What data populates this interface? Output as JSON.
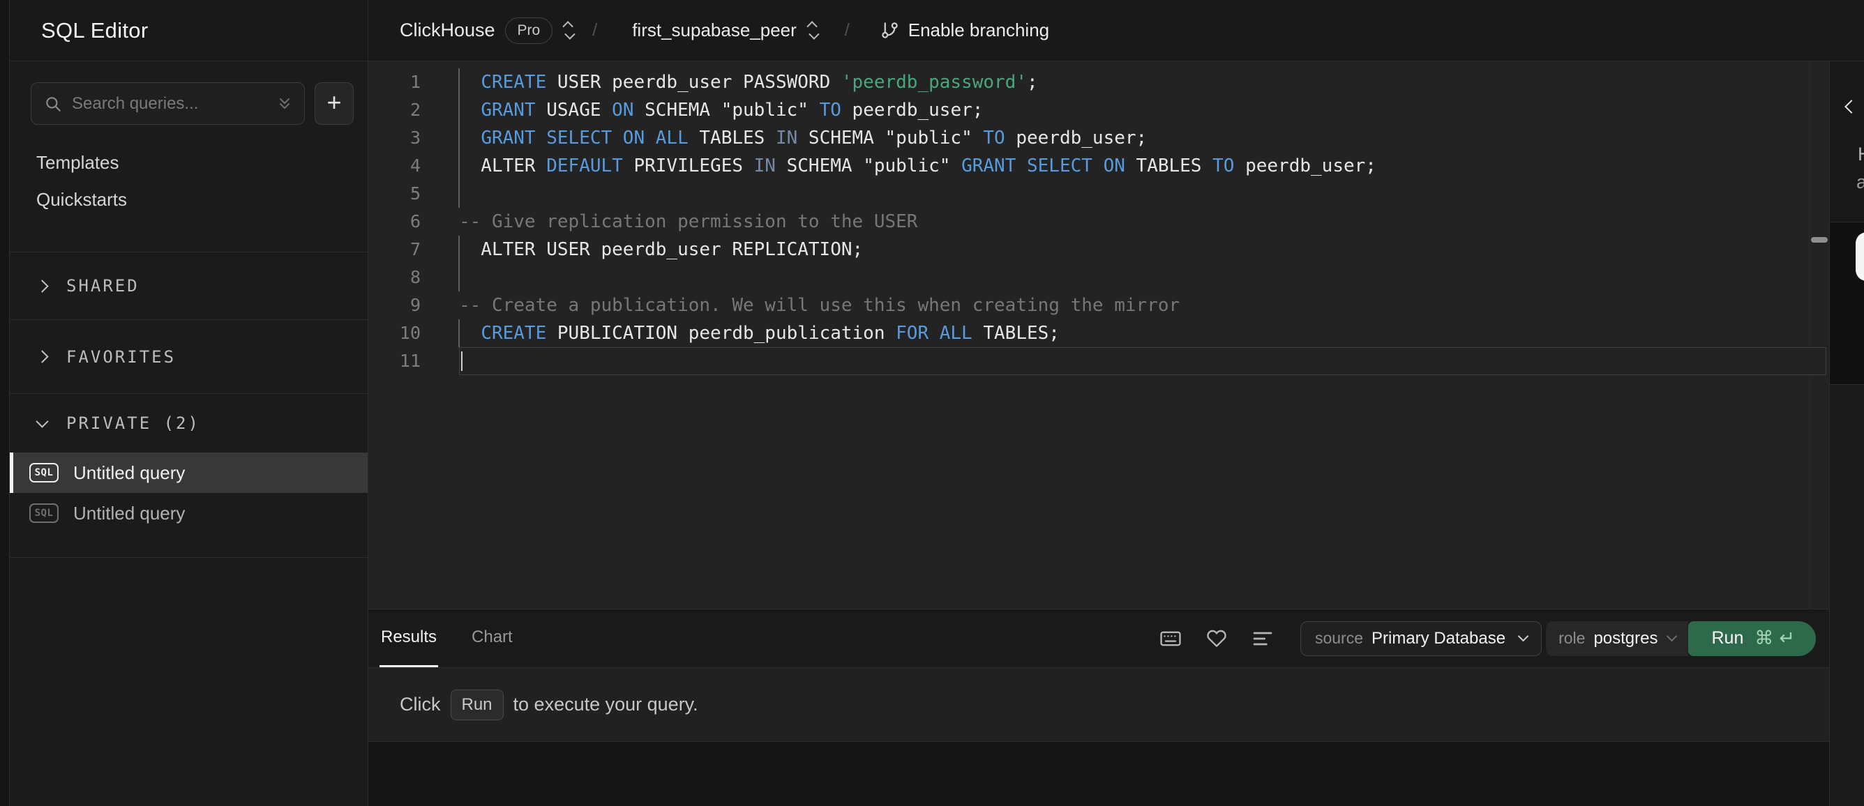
{
  "header": {
    "app_title": "SQL Editor",
    "breadcrumb": {
      "org": "ClickHouse",
      "org_badge": "Pro",
      "separator": "/",
      "service": "first_supabase_peer",
      "branch_action": "Enable branching"
    }
  },
  "sidebar": {
    "search": {
      "placeholder": "Search queries..."
    },
    "new_query_label": "+",
    "nav_items": [
      {
        "label": "Templates"
      },
      {
        "label": "Quickstarts"
      }
    ],
    "sections": [
      {
        "label": "SHARED",
        "state": "collapsed"
      },
      {
        "label": "FAVORITES",
        "state": "collapsed"
      },
      {
        "label": "PRIVATE (2)",
        "state": "expanded"
      }
    ],
    "queries": [
      {
        "badge": "SQL",
        "label": "Untitled query",
        "selected": true
      },
      {
        "badge": "SQL",
        "label": "Untitled query",
        "selected": false
      }
    ]
  },
  "editor": {
    "syntax_colors": {
      "keyword": "#579BDD",
      "keyword_muted": "#7389A6",
      "string": "#48A77E",
      "comment": "#777777",
      "plain": "#E6E6E6"
    },
    "lines": [
      {
        "num": 1,
        "marked": true,
        "active": false,
        "tokens": [
          [
            "  ",
            "plain"
          ],
          [
            "CREATE",
            "kw"
          ],
          [
            " USER peerdb_user PASSWORD ",
            "plain"
          ],
          [
            "'peerdb_password'",
            "str"
          ],
          [
            ";",
            "plain"
          ]
        ]
      },
      {
        "num": 2,
        "marked": true,
        "active": false,
        "tokens": [
          [
            "  ",
            "plain"
          ],
          [
            "GRANT",
            "kw"
          ],
          [
            " USAGE ",
            "plain"
          ],
          [
            "ON",
            "kw"
          ],
          [
            " SCHEMA \"public\" ",
            "plain"
          ],
          [
            "TO",
            "kw"
          ],
          [
            " peerdb_user;",
            "plain"
          ]
        ]
      },
      {
        "num": 3,
        "marked": true,
        "active": false,
        "tokens": [
          [
            "  ",
            "plain"
          ],
          [
            "GRANT SELECT ON ALL",
            "kw"
          ],
          [
            " TABLES ",
            "plain"
          ],
          [
            "IN",
            "kw-muted"
          ],
          [
            " SCHEMA \"public\" ",
            "plain"
          ],
          [
            "TO",
            "kw"
          ],
          [
            " peerdb_user;",
            "plain"
          ]
        ]
      },
      {
        "num": 4,
        "marked": true,
        "active": false,
        "tokens": [
          [
            "  ALTER ",
            "plain"
          ],
          [
            "DEFAULT",
            "kw"
          ],
          [
            " PRIVILEGES ",
            "plain"
          ],
          [
            "IN",
            "kw-muted"
          ],
          [
            " SCHEMA \"public\" ",
            "plain"
          ],
          [
            "GRANT SELECT ON",
            "kw"
          ],
          [
            " TABLES ",
            "plain"
          ],
          [
            "TO",
            "kw"
          ],
          [
            " peerdb_user;",
            "plain"
          ]
        ]
      },
      {
        "num": 5,
        "marked": true,
        "active": false,
        "tokens": []
      },
      {
        "num": 6,
        "marked": false,
        "active": false,
        "tokens": [
          [
            "-- Give replication permission to the USER",
            "comment"
          ]
        ]
      },
      {
        "num": 7,
        "marked": true,
        "active": false,
        "tokens": [
          [
            "  ALTER USER peerdb_user REPLICATION;",
            "plain"
          ]
        ]
      },
      {
        "num": 8,
        "marked": true,
        "active": false,
        "tokens": []
      },
      {
        "num": 9,
        "marked": false,
        "active": false,
        "tokens": [
          [
            "-- Create a publication. We will use this when creating the mirror",
            "comment"
          ]
        ]
      },
      {
        "num": 10,
        "marked": true,
        "active": false,
        "tokens": [
          [
            "  ",
            "plain"
          ],
          [
            "CREATE",
            "kw"
          ],
          [
            " PUBLICATION peerdb_publication ",
            "plain"
          ],
          [
            "FOR ALL",
            "kw"
          ],
          [
            " TABLES;",
            "plain"
          ]
        ]
      },
      {
        "num": 11,
        "marked": false,
        "active": true,
        "tokens": []
      }
    ]
  },
  "results_panel": {
    "tabs": [
      {
        "label": "Results",
        "active": true
      },
      {
        "label": "Chart",
        "active": false
      }
    ],
    "toolbar": {
      "source_label": "source",
      "source_value": "Primary Database",
      "role_label": "role",
      "role_value": "postgres",
      "run_label": "Run",
      "run_shortcut_keys": [
        "⌘",
        "↵"
      ],
      "run_color": "#2C6A4B"
    },
    "empty_state": {
      "prefix": "Click",
      "key_label": "Run",
      "suffix": "to execute your query."
    }
  },
  "right_panel": {
    "text_fragments": [
      "H",
      "a"
    ]
  }
}
